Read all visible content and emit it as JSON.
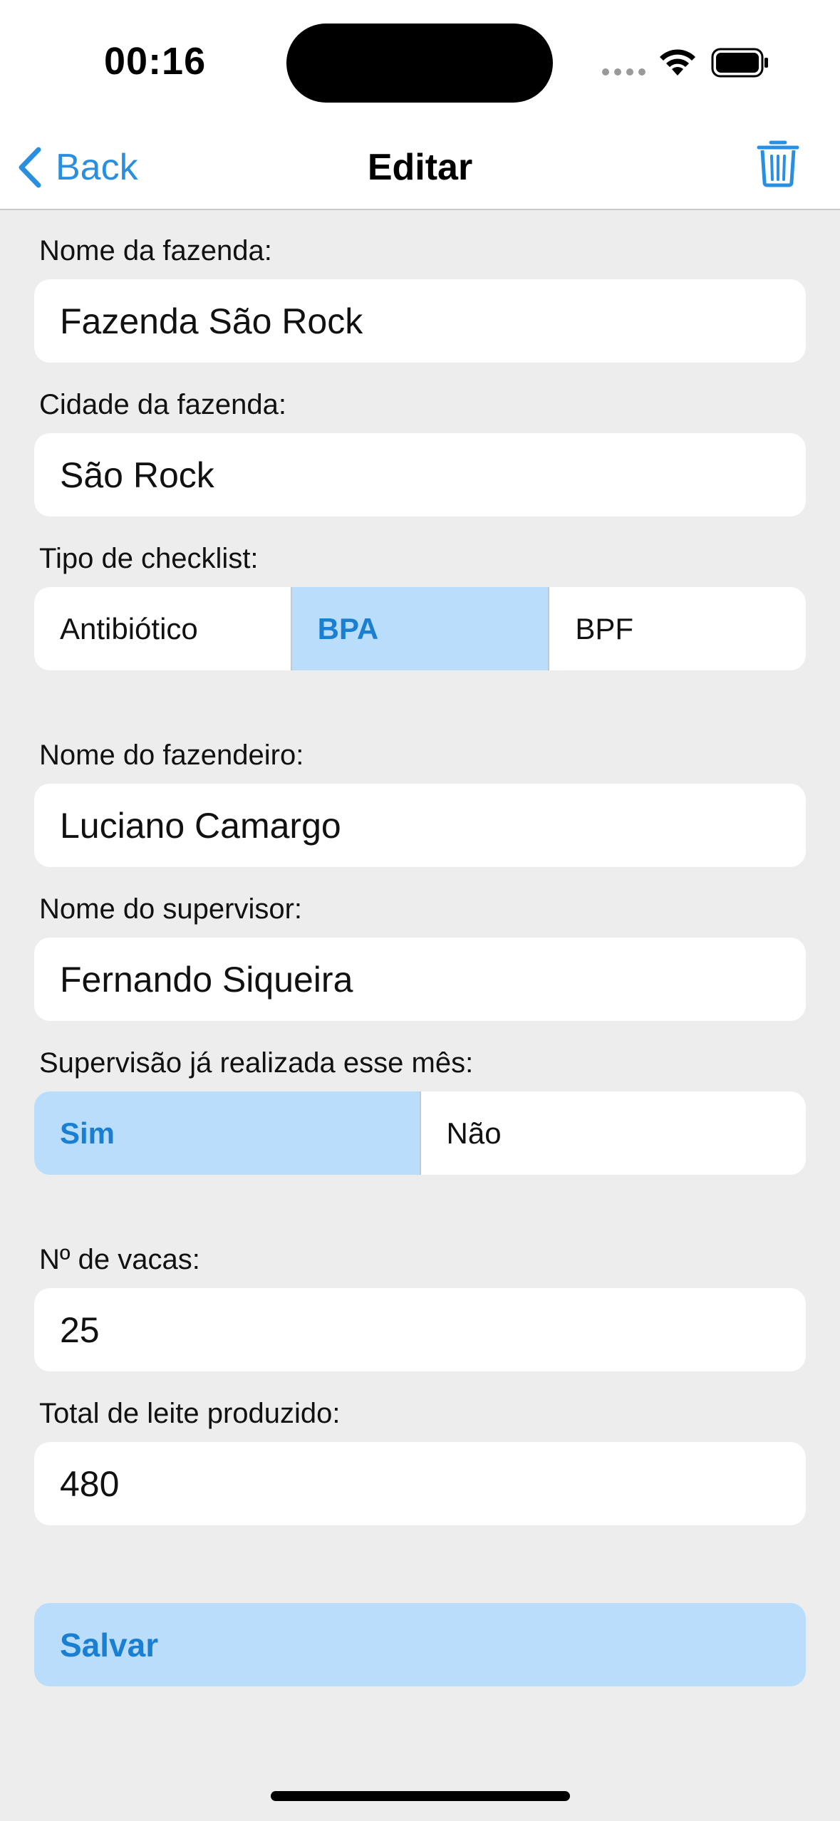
{
  "status_bar": {
    "time": "00:16"
  },
  "nav": {
    "back_label": "Back",
    "title": "Editar"
  },
  "form": {
    "farm_name": {
      "label": "Nome da fazenda:",
      "value": "Fazenda São Rock"
    },
    "farm_city": {
      "label": "Cidade da fazenda:",
      "value": "São Rock"
    },
    "checklist_type": {
      "label": "Tipo de checklist:",
      "options": [
        "Antibiótico",
        "BPA",
        "BPF"
      ],
      "selected": "BPA"
    },
    "farmer_name": {
      "label": "Nome do fazendeiro:",
      "value": "Luciano Camargo"
    },
    "supervisor_name": {
      "label": "Nome do supervisor:",
      "value": "Fernando Siqueira"
    },
    "supervision_done": {
      "label": "Supervisão já realizada esse mês:",
      "options": [
        "Sim",
        "Não"
      ],
      "selected": "Sim"
    },
    "cow_count": {
      "label": "Nº de vacas:",
      "value": "25"
    },
    "milk_total": {
      "label": "Total de leite produzido:",
      "value": "480"
    }
  },
  "save_label": "Salvar",
  "colors": {
    "accent": "#2b8fe0",
    "selected_bg": "#b9ddfb",
    "selected_text": "#1a7fd1",
    "background": "#ededed"
  },
  "icons": {
    "back": "chevron-left-icon",
    "delete": "trash-icon",
    "wifi": "wifi-icon",
    "battery": "battery-icon",
    "signal": "signal-dots-icon"
  }
}
